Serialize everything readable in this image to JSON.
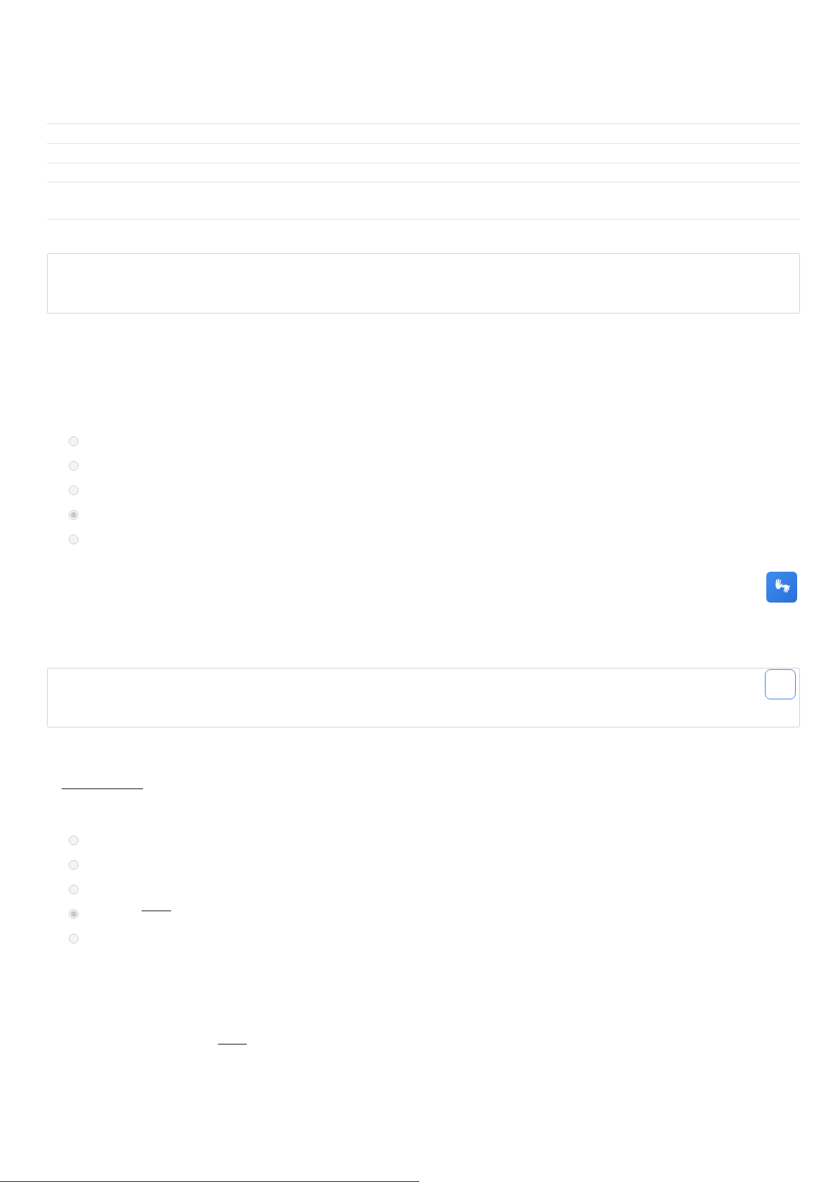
{
  "radio_groups": [
    {
      "options": [
        {
          "selected": false
        },
        {
          "selected": false
        },
        {
          "selected": false
        },
        {
          "selected": true
        },
        {
          "selected": false
        }
      ]
    },
    {
      "options": [
        {
          "selected": false
        },
        {
          "selected": false
        },
        {
          "selected": false
        },
        {
          "selected": true
        },
        {
          "selected": false
        }
      ]
    }
  ]
}
